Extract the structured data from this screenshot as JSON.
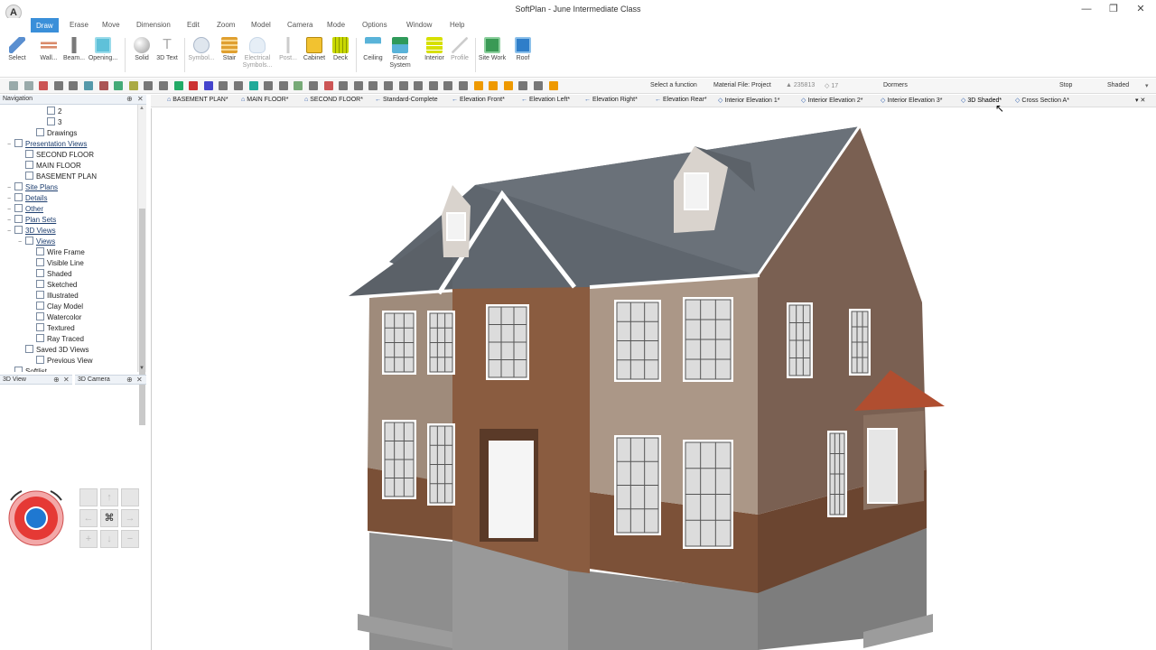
{
  "window": {
    "title": "SoftPlan - June Intermediate Class",
    "logo_letter": "A",
    "minimize": "—",
    "restore": "❐",
    "close": "✕"
  },
  "menu": [
    "Draw",
    "Erase",
    "Move",
    "Dimension",
    "Edit",
    "Zoom",
    "Model",
    "Camera",
    "Mode",
    "Options",
    "Window",
    "Help"
  ],
  "ribbon": [
    {
      "label": "Select",
      "icon": "select-icon",
      "color": "#5a8fd0"
    },
    {
      "label": "Wall...",
      "icon": "wall-icon",
      "color": "#d98a6a"
    },
    {
      "label": "Beam...",
      "icon": "beam-icon",
      "color": "#7a7a7a"
    },
    {
      "label": "Opening...",
      "icon": "opening-icon",
      "color": "#5fc1d9"
    },
    {
      "label": "Solid",
      "icon": "solid-icon",
      "color": "#bbbbbb"
    },
    {
      "label": "3D Text",
      "icon": "3d-text-icon",
      "color": "#999999"
    },
    {
      "label": "Symbol...",
      "icon": "symbol-icon",
      "color": "#aab7c9"
    },
    {
      "label": "Stair",
      "icon": "stair-icon",
      "color": "#e0a030"
    },
    {
      "label": "Electrical Symbols...",
      "icon": "electrical-icon",
      "color": "#c9d8e8"
    },
    {
      "label": "Post...",
      "icon": "post-icon",
      "color": "#bbbbbb"
    },
    {
      "label": "Cabinet",
      "icon": "cabinet-icon",
      "color": "#f2c230"
    },
    {
      "label": "Deck",
      "icon": "deck-icon",
      "color": "#c8d800"
    },
    {
      "label": "Ceiling",
      "icon": "ceiling-icon",
      "color": "#59b3d9"
    },
    {
      "label": "Floor System",
      "icon": "floor-system-icon",
      "color": "#2f9a5a"
    },
    {
      "label": "Interior",
      "icon": "interior-icon",
      "color": "#d7e000"
    },
    {
      "label": "Profile",
      "icon": "profile-icon",
      "color": "#cccccc"
    },
    {
      "label": "Site Work",
      "icon": "site-work-icon",
      "color": "#3a9a55"
    },
    {
      "label": "Roof",
      "icon": "roof-icon",
      "color": "#2f7ec9"
    }
  ],
  "toolbar": {
    "select_function": "Select a function",
    "material_file": "Material File: Project",
    "count1": "▲ 235813",
    "count2": "◇ 17",
    "dormers": "Dormers",
    "stop": "Stop",
    "render_mode": "Shaded"
  },
  "view_tabs": [
    "BASEMENT PLAN*",
    "MAIN FLOOR*",
    "SECOND FLOOR*",
    "Standard-Complete",
    "Elevation Front*",
    "Elevation Left*",
    "Elevation Right*",
    "Elevation Rear*",
    "Interior Elevation 1*",
    "Interior Elevation 2*",
    "Interior Elevation 3*",
    "3D Shaded*",
    "Cross Section A*"
  ],
  "navigation": {
    "title": "Navigation",
    "pin": "⊕",
    "close": "✕",
    "tree": [
      {
        "label": "2",
        "style": "plain"
      },
      {
        "label": "3",
        "style": "plain"
      },
      {
        "label": "Drawings",
        "style": "plain"
      },
      {
        "label": "Presentation Views",
        "style": "link"
      },
      {
        "label": "SECOND FLOOR",
        "style": "plain"
      },
      {
        "label": "MAIN FLOOR",
        "style": "plain"
      },
      {
        "label": "BASEMENT PLAN",
        "style": "plain"
      },
      {
        "label": "Site Plans",
        "style": "link"
      },
      {
        "label": "Details",
        "style": "link"
      },
      {
        "label": "Other",
        "style": "link"
      },
      {
        "label": "Plan Sets",
        "style": "link"
      },
      {
        "label": "3D Views",
        "style": "link"
      },
      {
        "label": "Views",
        "style": "link"
      },
      {
        "label": "Wire Frame",
        "style": "plain"
      },
      {
        "label": "Visible Line",
        "style": "plain"
      },
      {
        "label": "Shaded",
        "style": "plain"
      },
      {
        "label": "Sketched",
        "style": "plain"
      },
      {
        "label": "Illustrated",
        "style": "plain"
      },
      {
        "label": "Clay Model",
        "style": "plain"
      },
      {
        "label": "Watercolor",
        "style": "plain"
      },
      {
        "label": "Textured",
        "style": "plain"
      },
      {
        "label": "Ray Traced",
        "style": "plain"
      },
      {
        "label": "Saved 3D Views",
        "style": "plain"
      },
      {
        "label": "Previous View",
        "style": "plain"
      },
      {
        "label": "Softlist",
        "style": "plain"
      }
    ]
  },
  "panels": {
    "view3d": "3D View",
    "camera3d": "3D Camera",
    "pin": "⊕",
    "close": "✕"
  },
  "camera_buttons": {
    "up": "↑",
    "left": "←",
    "right": "→",
    "down": "↓",
    "plus": "+",
    "minus": "−",
    "binoculars": "⌘"
  }
}
